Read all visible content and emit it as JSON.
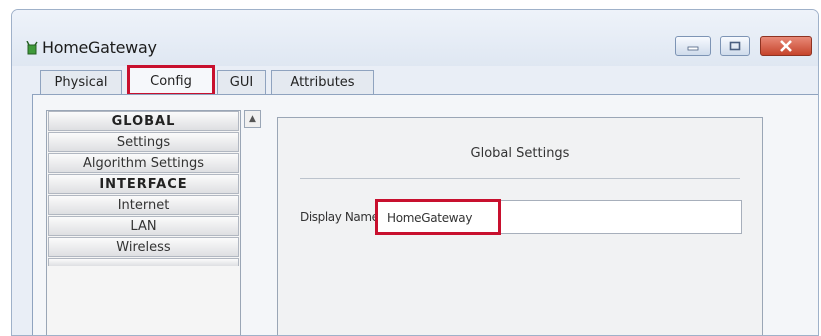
{
  "window": {
    "title": "HomeGateway",
    "icon": "green-router-icon",
    "controls": {
      "minimize": "minimize-icon",
      "maximize": "maximize-icon",
      "close": "close-icon"
    },
    "close_color": "#c6442c"
  },
  "tabs": [
    {
      "label": "Physical",
      "selected": false
    },
    {
      "label": "Config",
      "selected": true,
      "highlighted": true
    },
    {
      "label": "GUI",
      "selected": false
    },
    {
      "label": "Attributes",
      "selected": false
    }
  ],
  "sidebar": {
    "items": [
      {
        "label": "GLOBAL",
        "type": "header"
      },
      {
        "label": "Settings",
        "type": "item"
      },
      {
        "label": "Algorithm Settings",
        "type": "item"
      },
      {
        "label": "INTERFACE",
        "type": "header"
      },
      {
        "label": "Internet",
        "type": "item"
      },
      {
        "label": "LAN",
        "type": "item"
      },
      {
        "label": "Wireless",
        "type": "item"
      }
    ]
  },
  "panel": {
    "title": "Global Settings",
    "display_name_label": "Display Name",
    "display_name_value": "HomeGateway"
  },
  "highlight_color": "#c8102e"
}
